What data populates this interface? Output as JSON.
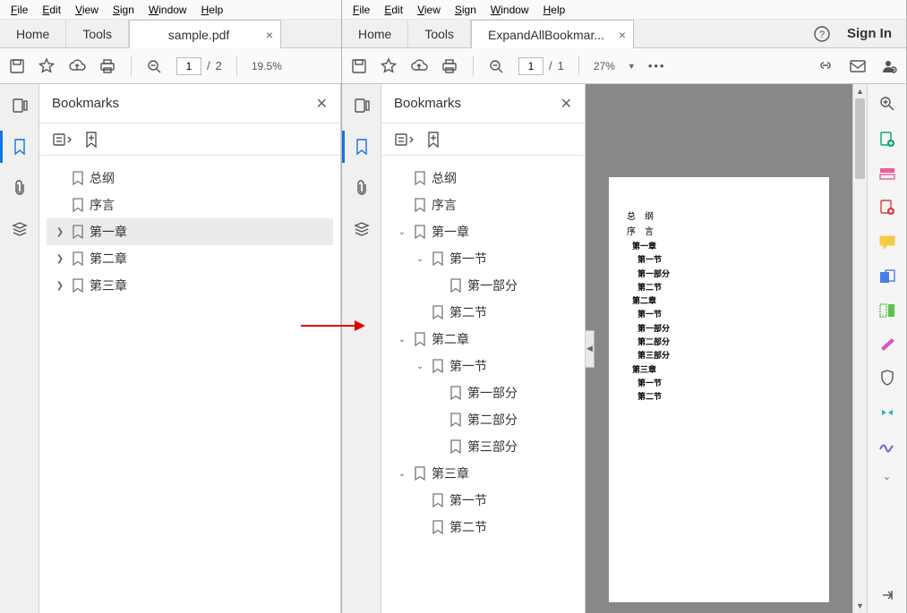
{
  "menu": {
    "items": [
      "File",
      "Edit",
      "View",
      "Sign",
      "Window",
      "Help"
    ]
  },
  "tabs": {
    "home": "Home",
    "tools": "Tools",
    "help_icon": "help-icon",
    "signin": "Sign In"
  },
  "left": {
    "doc_tab": "sample.pdf",
    "page_current": "1",
    "page_sep": "/",
    "page_total": "2",
    "zoom": "19.5%",
    "panel_title": "Bookmarks",
    "bookmarks": [
      {
        "label": "总纲",
        "depth": 0,
        "chev": "",
        "sel": false
      },
      {
        "label": "序言",
        "depth": 0,
        "chev": "",
        "sel": false
      },
      {
        "label": "第一章",
        "depth": 0,
        "chev": "right",
        "sel": true
      },
      {
        "label": "第二章",
        "depth": 0,
        "chev": "right",
        "sel": false
      },
      {
        "label": "第三章",
        "depth": 0,
        "chev": "right",
        "sel": false
      }
    ]
  },
  "right": {
    "doc_tab": "ExpandAllBookmar...",
    "page_current": "1",
    "page_sep": "/",
    "page_total": "1",
    "zoom": "27%",
    "panel_title": "Bookmarks",
    "bookmarks": [
      {
        "label": "总纲",
        "depth": 0,
        "chev": ""
      },
      {
        "label": "序言",
        "depth": 0,
        "chev": ""
      },
      {
        "label": "第一章",
        "depth": 0,
        "chev": "down"
      },
      {
        "label": "第一节",
        "depth": 1,
        "chev": "down"
      },
      {
        "label": "第一部分",
        "depth": 2,
        "chev": ""
      },
      {
        "label": "第二节",
        "depth": 1,
        "chev": ""
      },
      {
        "label": "第二章",
        "depth": 0,
        "chev": "down"
      },
      {
        "label": "第一节",
        "depth": 1,
        "chev": "down"
      },
      {
        "label": "第一部分",
        "depth": 2,
        "chev": ""
      },
      {
        "label": "第二部分",
        "depth": 2,
        "chev": ""
      },
      {
        "label": "第三部分",
        "depth": 2,
        "chev": ""
      },
      {
        "label": "第三章",
        "depth": 0,
        "chev": "down"
      },
      {
        "label": "第一节",
        "depth": 1,
        "chev": ""
      },
      {
        "label": "第二节",
        "depth": 1,
        "chev": ""
      }
    ],
    "page_lines": [
      {
        "t": "总　纲",
        "i": 0
      },
      {
        "t": "序　言",
        "i": 0
      },
      {
        "t": "第一章",
        "i": 1
      },
      {
        "t": "第一节",
        "i": 2
      },
      {
        "t": "第一部分",
        "i": 2
      },
      {
        "t": "第二节",
        "i": 2
      },
      {
        "t": "第二章",
        "i": 1
      },
      {
        "t": "第一节",
        "i": 2
      },
      {
        "t": "第一部分",
        "i": 2
      },
      {
        "t": "第二部分",
        "i": 2
      },
      {
        "t": "第三部分",
        "i": 2
      },
      {
        "t": "第三章",
        "i": 1
      },
      {
        "t": "第一节",
        "i": 2
      },
      {
        "t": "第二节",
        "i": 2
      }
    ]
  }
}
